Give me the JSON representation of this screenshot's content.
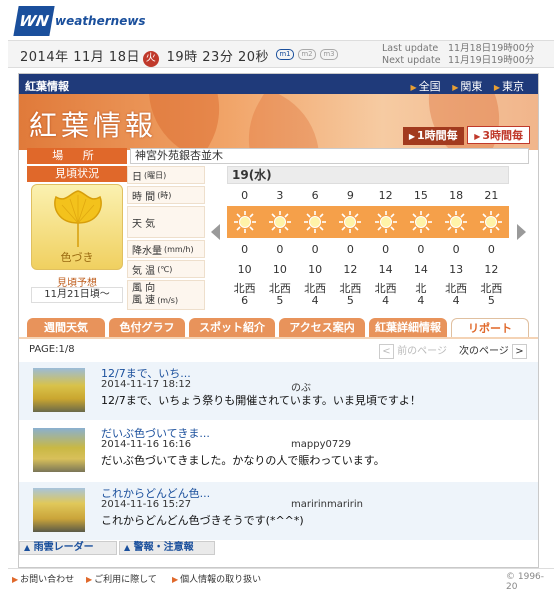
{
  "brand": {
    "logo": "WN",
    "name": "weathernews"
  },
  "datebar": {
    "year": "2014年",
    "month": "11月",
    "day": "18日",
    "weekday": "火",
    "time": "19時 23分 20秒",
    "moons": [
      "m1",
      "m2",
      "m3"
    ],
    "last_update_label": "Last update",
    "last_update": "11月18日19時00分",
    "next_update_label": "Next update",
    "next_update": "11月19日19時00分"
  },
  "topbar": {
    "title": "紅葉情報",
    "links": [
      "全国",
      "関東",
      "東京"
    ]
  },
  "banner": {
    "title": "紅葉情報",
    "btn1": "1時間毎",
    "btn3": "3時間毎"
  },
  "place": {
    "label": "場 所",
    "value": "神宮外苑銀杏並木"
  },
  "status": {
    "label": "見頃状況",
    "caption": "色づき",
    "forecast_label": "見頃予想",
    "forecast_value": "11月21日頃～"
  },
  "weather": {
    "date_label": "日",
    "date_sub": "(曜日)",
    "day": "19(水)",
    "time_label": "時 間",
    "time_sub": "(時)",
    "hours": [
      "0",
      "3",
      "6",
      "9",
      "12",
      "15",
      "18",
      "21"
    ],
    "wx_label": "天 気",
    "wx_icon": "sun-icon",
    "rain_label": "降水量",
    "rain_sub": "(mm/h)",
    "rain": [
      "0",
      "0",
      "0",
      "0",
      "0",
      "0",
      "0",
      "0"
    ],
    "temp_label": "気 温",
    "temp_sub": "(℃)",
    "temp": [
      "10",
      "10",
      "10",
      "12",
      "14",
      "14",
      "13",
      "12"
    ],
    "wind_label1": "風 向",
    "wind_label2": "風 速",
    "wind_sub": "(m/s)",
    "wind_dir": [
      "北西",
      "北西",
      "北西",
      "北西",
      "北西",
      "北",
      "北西",
      "北西"
    ],
    "wind_speed": [
      "6",
      "5",
      "4",
      "5",
      "4",
      "4",
      "4",
      "5"
    ]
  },
  "tabs": [
    "週間天気",
    "色付グラフ",
    "スポット紹介",
    "アクセス案内",
    "紅葉詳細情報",
    "リポート"
  ],
  "pager": {
    "page": "PAGE:1/8",
    "prev": "前のページ",
    "next": "次のページ"
  },
  "reports": [
    {
      "title": "12/7まで、いち...",
      "date": "2014-11-17 18:12",
      "user": "のぶ",
      "body": "12/7まで、いちょう祭りも開催されています。いま見頃ですよ！"
    },
    {
      "title": "だいぶ色づいてきま...",
      "date": "2014-11-16 16:16",
      "user": "mappy0729",
      "body": "だいぶ色づいてきました。かなりの人で賑わっています。"
    },
    {
      "title": "これからどんどん色...",
      "date": "2014-11-16 15:27",
      "user": "maririnmaririn",
      "body": "これからどんどん色づきそうです(*^^*)"
    }
  ],
  "bottom_tabs": [
    "雨雲レーダー",
    "警報・注意報"
  ],
  "footer": {
    "links": [
      "お問い合わせ",
      "ご利用に際して",
      "個人情報の取り扱い"
    ],
    "copyright": "© 1996-20"
  },
  "colors": {
    "accent": "#e0682a",
    "brand": "#1a4f9c",
    "topbar": "#1f3a7a"
  }
}
